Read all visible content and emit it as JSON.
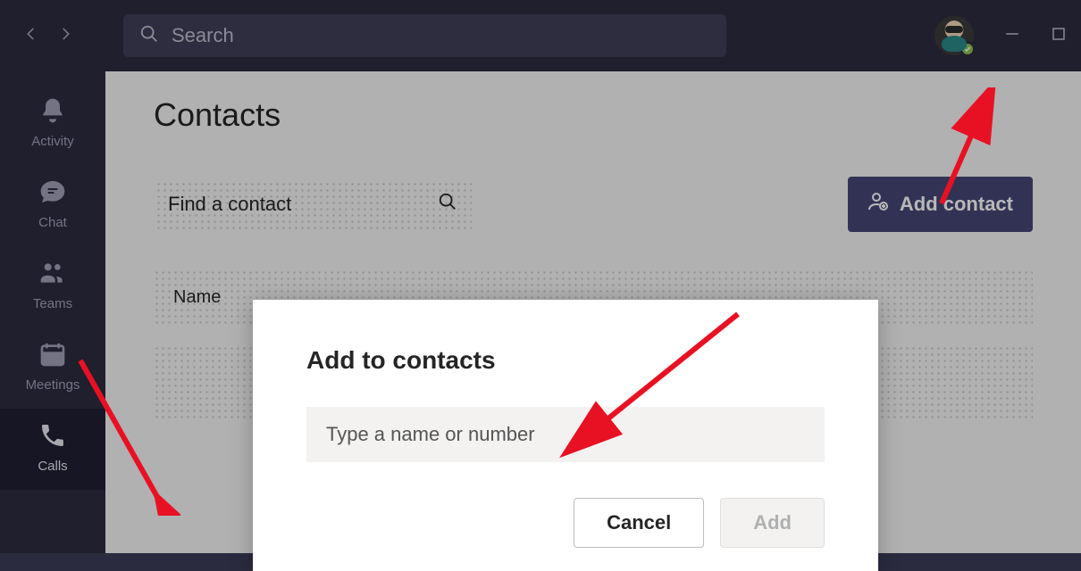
{
  "titlebar": {
    "search_placeholder": "Search"
  },
  "rail": {
    "items": [
      {
        "label": "Activity"
      },
      {
        "label": "Chat"
      },
      {
        "label": "Teams"
      },
      {
        "label": "Meetings"
      },
      {
        "label": "Calls"
      }
    ]
  },
  "page": {
    "title": "Contacts",
    "find_placeholder": "Find a contact",
    "add_contact_label": "Add contact",
    "columns": {
      "name": "Name"
    }
  },
  "modal": {
    "title": "Add to contacts",
    "input_placeholder": "Type a name or number",
    "cancel_label": "Cancel",
    "add_label": "Add"
  }
}
